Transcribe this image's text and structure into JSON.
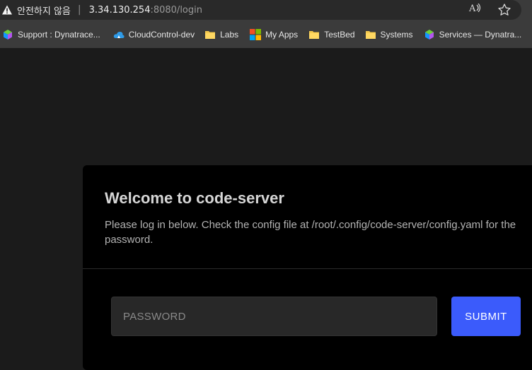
{
  "address_bar": {
    "security_text": "안전하지 않음",
    "separator": "|",
    "url_host": "3.34.130.254",
    "url_rest": ":8080/login",
    "read_aloud_glyph": "A",
    "icons": [
      "warning-icon",
      "read-aloud-icon",
      "favorite-star-icon"
    ]
  },
  "bookmarks": [
    {
      "label": "Support : Dynatrace...",
      "icon": "dynatrace-icon"
    },
    {
      "label": "CloudControl-dev",
      "icon": "cloud-icon"
    },
    {
      "label": "Labs",
      "icon": "folder-icon"
    },
    {
      "label": "My Apps",
      "icon": "microsoft-icon"
    },
    {
      "label": "TestBed",
      "icon": "folder-icon"
    },
    {
      "label": "Systems",
      "icon": "folder-icon"
    },
    {
      "label": "Services — Dynatra...",
      "icon": "dynatrace-icon"
    }
  ],
  "login": {
    "title": "Welcome to code-server",
    "description": "Please log in below. Check the config file at /root/.config/code-server/config.yaml for the password.",
    "password_placeholder": "PASSWORD",
    "password_value": "",
    "submit_label": "SUBMIT"
  },
  "colors": {
    "page_bg": "#1b1b1b",
    "card_bg": "#000000",
    "submit_bg": "#3b5bfb",
    "folder": "#f4c94e"
  }
}
